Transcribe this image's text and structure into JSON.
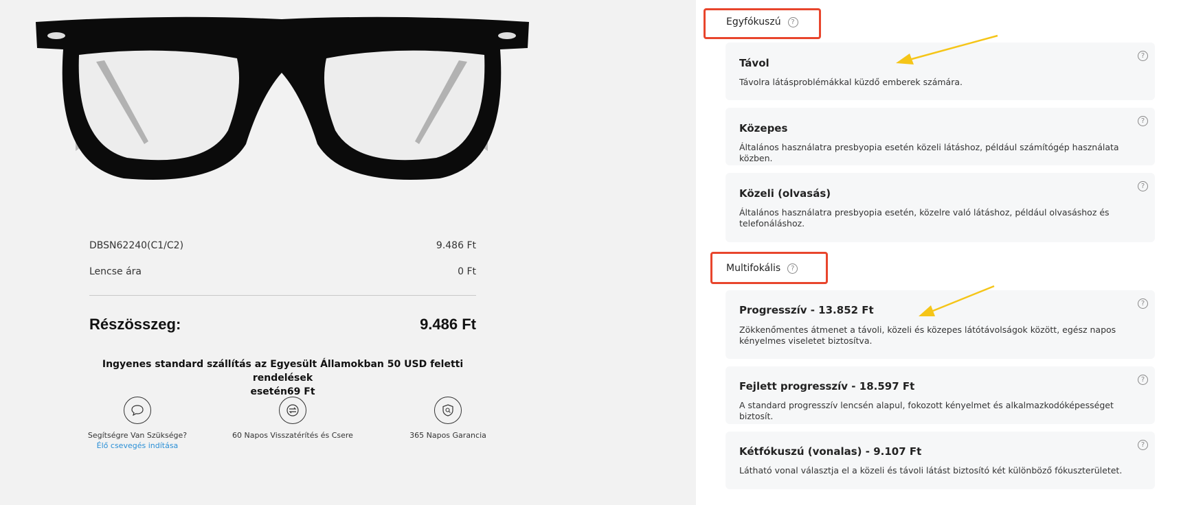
{
  "product": {
    "sku": "DBSN62240(C1/C2)",
    "sku_price": "9.486 Ft",
    "lens_label": "Lencse ára",
    "lens_price": "0 Ft",
    "subtotal_label": "Részösszeg:",
    "subtotal_value": "9.486 Ft",
    "shipping_line1": "Ingyenes standard szállítás az Egyesült Államokban 50 USD feletti rendelések",
    "shipping_line2": "esetén69 Ft"
  },
  "features": [
    {
      "icon": "chat-bubble-icon",
      "label": "Segítségre Van Szüksége?",
      "link": "Élő csevegés indítása"
    },
    {
      "icon": "exchange-icon",
      "label": "60 Napos Visszatérítés és Csere",
      "link": ""
    },
    {
      "icon": "shield-icon",
      "label": "365 Napos Garancia",
      "link": ""
    }
  ],
  "lens_groups": {
    "single": {
      "label": "Egyfókuszú",
      "options": [
        {
          "title": "Távol",
          "desc": "Távolra látásproblémákkal küzdő emberek számára."
        },
        {
          "title": "Közepes",
          "desc": "Általános használatra presbyopia esetén közeli látáshoz, például számítógép használata közben."
        },
        {
          "title": "Közeli (olvasás)",
          "desc": "Általános használatra presbyopia esetén, közelre való látáshoz, például olvasáshoz és telefonáláshoz."
        }
      ]
    },
    "multi": {
      "label": "Multifokális",
      "options": [
        {
          "title": "Progresszív - 13.852 Ft",
          "desc": "Zökkenőmentes átmenet a távoli, közeli és közepes látótávolságok között, egész napos kényelmes viseletet biztosítva."
        },
        {
          "title": "Fejlett progresszív - 18.597 Ft",
          "desc": "A standard progresszív lencsén alapul, fokozott kényelmet és alkalmazkodóképességet biztosít."
        },
        {
          "title": "Kétfókuszú (vonalas) - 9.107 Ft",
          "desc": "Látható vonal választja el a közeli és távoli látást biztosító két különböző fókuszterületet."
        }
      ]
    }
  },
  "help_icon": "?",
  "colors": {
    "highlight": "#e8452c",
    "arrow": "#f5c518",
    "link": "#2a8fd6",
    "card_bg": "#f6f7f8"
  }
}
